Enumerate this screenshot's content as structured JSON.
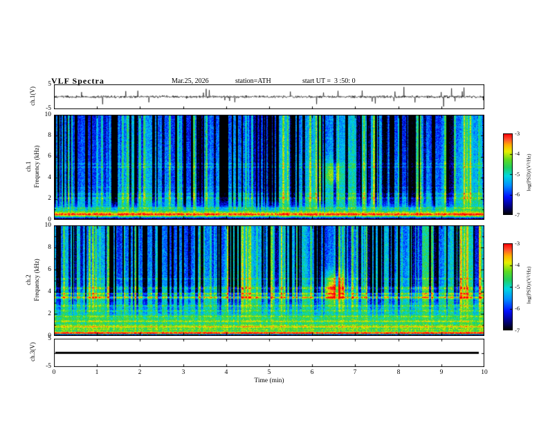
{
  "header": {
    "title": "VLF Spectra",
    "date": "Mar.25, 2026",
    "station": "station=ATH",
    "start_ut": "start UT =  3 :50: 0"
  },
  "axes": {
    "time_label": "Time (min)",
    "time_range_min": [
      0,
      10
    ],
    "time_ticks": [
      "0",
      "1",
      "2",
      "3",
      "4",
      "5",
      "6",
      "7",
      "8",
      "9",
      "10"
    ],
    "freq_ticks": [
      "10",
      "8",
      "6",
      "4",
      "2",
      "0"
    ],
    "volt_ticks": [
      "5",
      "-5"
    ]
  },
  "panels": {
    "ch1_wave": {
      "label": "ch.1(V)"
    },
    "spec1": {
      "line1": "ch.1",
      "line2": "Frequency (kHz)"
    },
    "spec2": {
      "line1": "ch.2",
      "line2": "Frequency (kHz)"
    },
    "ch3_wave": {
      "label": "ch.3(V)"
    }
  },
  "colorbar": {
    "label": "log(PSD)/(V²/Hz)",
    "ticks": [
      "-3",
      "-4",
      "-5",
      "-6",
      "-7"
    ],
    "range": [
      -7,
      -3
    ],
    "stops": [
      {
        "t": 0.0,
        "c": "#000000"
      },
      {
        "t": 0.1,
        "c": "#000080"
      },
      {
        "t": 0.22,
        "c": "#0010ff"
      },
      {
        "t": 0.36,
        "c": "#0090ff"
      },
      {
        "t": 0.48,
        "c": "#00d8e0"
      },
      {
        "t": 0.58,
        "c": "#20d060"
      },
      {
        "t": 0.68,
        "c": "#60dc20"
      },
      {
        "t": 0.78,
        "c": "#e8f000"
      },
      {
        "t": 0.86,
        "c": "#ffb000"
      },
      {
        "t": 0.93,
        "c": "#ff5030"
      },
      {
        "t": 1.0,
        "c": "#ff0000"
      }
    ]
  },
  "chart_data": [
    {
      "id": "ch1_waveform",
      "type": "line",
      "channel": "ch.1",
      "units": "V",
      "x_range_min": [
        0,
        10
      ],
      "y_range": [
        -5,
        5
      ],
      "baseline_V": 0,
      "noise_amp_V": 0.7,
      "spike_amp_max_V": 4.5,
      "description": "Noisy broadband voltage trace centered on 0 V with dense impulsive spikes reaching about ±4 V across the full 10 minutes"
    },
    {
      "id": "ch1_spectrogram",
      "type": "heatmap",
      "channel": "ch.1",
      "x_range_min": [
        0,
        10
      ],
      "y_range_kHz": [
        0,
        10
      ],
      "value_label": "log(PSD)/(V²/Hz)",
      "value_range": [
        -7,
        -3
      ],
      "colormap": "jet",
      "base_profile": [
        [
          0,
          -7
        ],
        [
          0.15,
          -6.6
        ],
        [
          0.3,
          -4.9
        ],
        [
          0.5,
          -4.05
        ],
        [
          0.75,
          -4.2
        ],
        [
          1.0,
          -4.8
        ],
        [
          1.4,
          -5.0
        ],
        [
          1.9,
          -4.9
        ],
        [
          2.4,
          -5.05
        ],
        [
          3.0,
          -5.3
        ],
        [
          4.0,
          -5.3
        ],
        [
          6.0,
          -5.35
        ],
        [
          8.0,
          -5.45
        ],
        [
          10.0,
          -5.5
        ]
      ],
      "horizontal_bands": [
        {
          "f_kHz": 0.55,
          "amp": 1.1,
          "width_kHz": 0.1
        },
        {
          "f_kHz": 1.15,
          "amp": 0.5,
          "width_kHz": 0.06
        },
        {
          "f_kHz": 2.1,
          "amp": 0.5,
          "width_kHz": 0.07
        },
        {
          "f_kHz": 2.5,
          "amp": 0.45,
          "width_kHz": 0.06
        },
        {
          "f_kHz": 3.1,
          "amp": 0.3,
          "width_kHz": 0.05
        },
        {
          "f_kHz": 5.05,
          "amp": 0.5,
          "width_kHz": 0.05
        },
        {
          "f_kHz": 5.35,
          "amp": 0.4,
          "width_kHz": 0.05
        }
      ],
      "vertical_streaks": {
        "neg_prob": 0.2,
        "pos_prob": 0.1,
        "ramp_kHz": [
          0.8,
          2.2
        ],
        "min_weight": 0.15,
        "description": "dense dark-blue dropout columns and bright green-yellow burst columns spanning the band"
      },
      "event_blob": {
        "t_min": 6.45,
        "f_kHz": 4.3,
        "amp": 1.3,
        "sigma_t_min": 0.16,
        "sigma_f_kHz": 0.8
      },
      "noise_amp": 0.42
    },
    {
      "id": "ch2_spectrogram",
      "type": "heatmap",
      "channel": "ch.2",
      "x_range_min": [
        0,
        10
      ],
      "y_range_kHz": [
        0,
        10
      ],
      "value_label": "log(PSD)/(V²/Hz)",
      "value_range": [
        -7,
        -3
      ],
      "colormap": "jet",
      "base_profile": [
        [
          0,
          -7
        ],
        [
          0.12,
          -6.8
        ],
        [
          0.25,
          -4.3
        ],
        [
          0.45,
          -4.7
        ],
        [
          0.6,
          -4.1
        ],
        [
          0.8,
          -4.7
        ],
        [
          1.0,
          -4.35
        ],
        [
          1.25,
          -4.8
        ],
        [
          1.55,
          -4.55
        ],
        [
          2.1,
          -4.9
        ],
        [
          2.7,
          -4.8
        ],
        [
          3.2,
          -5.0
        ],
        [
          3.55,
          -4.6
        ],
        [
          4.0,
          -5.05
        ],
        [
          4.6,
          -5.25
        ],
        [
          5.5,
          -5.35
        ],
        [
          7.0,
          -5.4
        ],
        [
          10.0,
          -5.5
        ]
      ],
      "horizontal_bands": [
        {
          "f_kHz": 0.3,
          "amp": 1.5,
          "width_kHz": 0.08
        },
        {
          "f_kHz": 0.85,
          "amp": 1.0,
          "width_kHz": 0.06
        },
        {
          "f_kHz": 1.35,
          "amp": 0.8,
          "width_kHz": 0.06
        },
        {
          "f_kHz": 1.8,
          "amp": 0.6,
          "width_kHz": 0.05
        },
        {
          "f_kHz": 2.3,
          "amp": 0.5,
          "width_kHz": 0.05
        },
        {
          "f_kHz": 2.75,
          "amp": 0.5,
          "width_kHz": 0.05
        },
        {
          "f_kHz": 3.5,
          "amp": 1.2,
          "width_kHz": 0.06
        },
        {
          "f_kHz": 3.85,
          "amp": 0.9,
          "width_kHz": 0.05
        },
        {
          "f_kHz": 4.35,
          "amp": 0.7,
          "width_kHz": 0.09
        },
        {
          "f_kHz": 5.2,
          "amp": 0.5,
          "width_kHz": 0.05
        }
      ],
      "vertical_streaks": {
        "neg_prob": 0.18,
        "pos_prob": 0.1,
        "ramp_kHz": [
          1.5,
          4.5
        ],
        "min_weight": 0.12,
        "description": "blue dropout columns mostly above 4 kHz; strong red/yellow horizontal banding below 4 kHz"
      },
      "event_blob": {
        "t_min": 6.5,
        "f_kHz": 4.4,
        "amp": 1.9,
        "sigma_t_min": 0.18,
        "sigma_f_kHz": 0.9
      },
      "noise_amp": 0.42
    },
    {
      "id": "ch3_waveform",
      "type": "line",
      "channel": "ch.3",
      "units": "V",
      "x_range_min": [
        0,
        10
      ],
      "y_range": [
        -5,
        5
      ],
      "value_V": 0,
      "description": "Constant flat line at 0 V (no signal on channel 3)"
    }
  ]
}
